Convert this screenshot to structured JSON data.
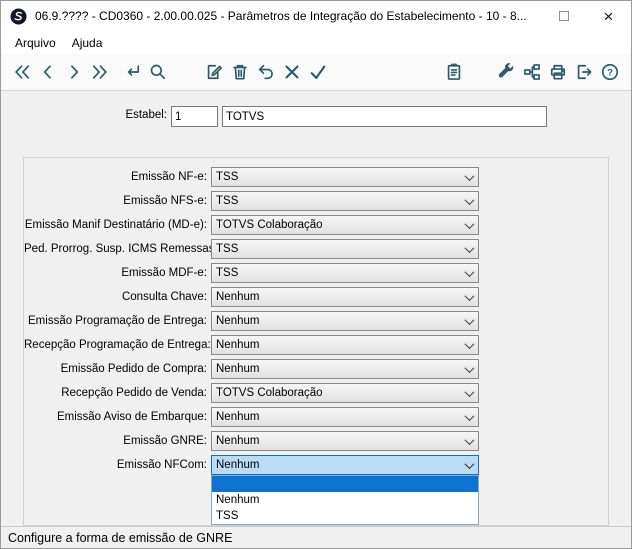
{
  "window": {
    "title": "06.9.???? - CD0360 - 2.00.00.025 - Parâmetros de Integração do Estabelecimento - 10 - 8...",
    "close_glyph": "×"
  },
  "menu": {
    "items": [
      {
        "label": "Arquivo"
      },
      {
        "label": "Ajuda"
      }
    ]
  },
  "toolbar": {
    "icons": [
      "first-record",
      "previous-record",
      "next-record",
      "last-record",
      "go-to",
      "search",
      "edit",
      "delete",
      "undo",
      "cancel",
      "confirm",
      "clipboard",
      "tools",
      "network",
      "print",
      "exit",
      "help"
    ],
    "icon_color": "#2a5c6c"
  },
  "form": {
    "estabel": {
      "label": "Estabel:",
      "code": "1",
      "name": "TOTVS"
    },
    "fields": [
      {
        "label": "Emissão NF-e:",
        "value": "TSS"
      },
      {
        "label": "Emissão NFS-e:",
        "value": "TSS"
      },
      {
        "label": "Emissão Manif Destinatário (MD-e):",
        "value": "TOTVS Colaboração"
      },
      {
        "label": "Ped. Prorrog. Susp. ICMS Remessas:",
        "value": "TSS"
      },
      {
        "label": "Emissão MDF-e:",
        "value": "TSS"
      },
      {
        "label": "Consulta Chave:",
        "value": "Nenhum"
      },
      {
        "label": "Emissão Programação de Entrega:",
        "value": "Nenhum"
      },
      {
        "label": "Recepção Programação de Entrega:",
        "value": "Nenhum"
      },
      {
        "label": "Emissão Pedido de Compra:",
        "value": "Nenhum"
      },
      {
        "label": "Recepção Pedido de Venda:",
        "value": "TOTVS Colaboração"
      },
      {
        "label": "Emissão Aviso de Embarque:",
        "value": "Nenhum"
      },
      {
        "label": "Emissão GNRE:",
        "value": "Nenhum"
      },
      {
        "label": "Emissão NFCom:",
        "value": "Nenhum"
      }
    ],
    "dropdown": {
      "field": "Emissão NFCom",
      "items": [
        "",
        "Nenhum",
        "TSS"
      ],
      "highlighted_index": 0,
      "highlight_color": "#0e73d0"
    }
  },
  "statusbar": {
    "text": "Configure a forma de emissão de GNRE"
  }
}
